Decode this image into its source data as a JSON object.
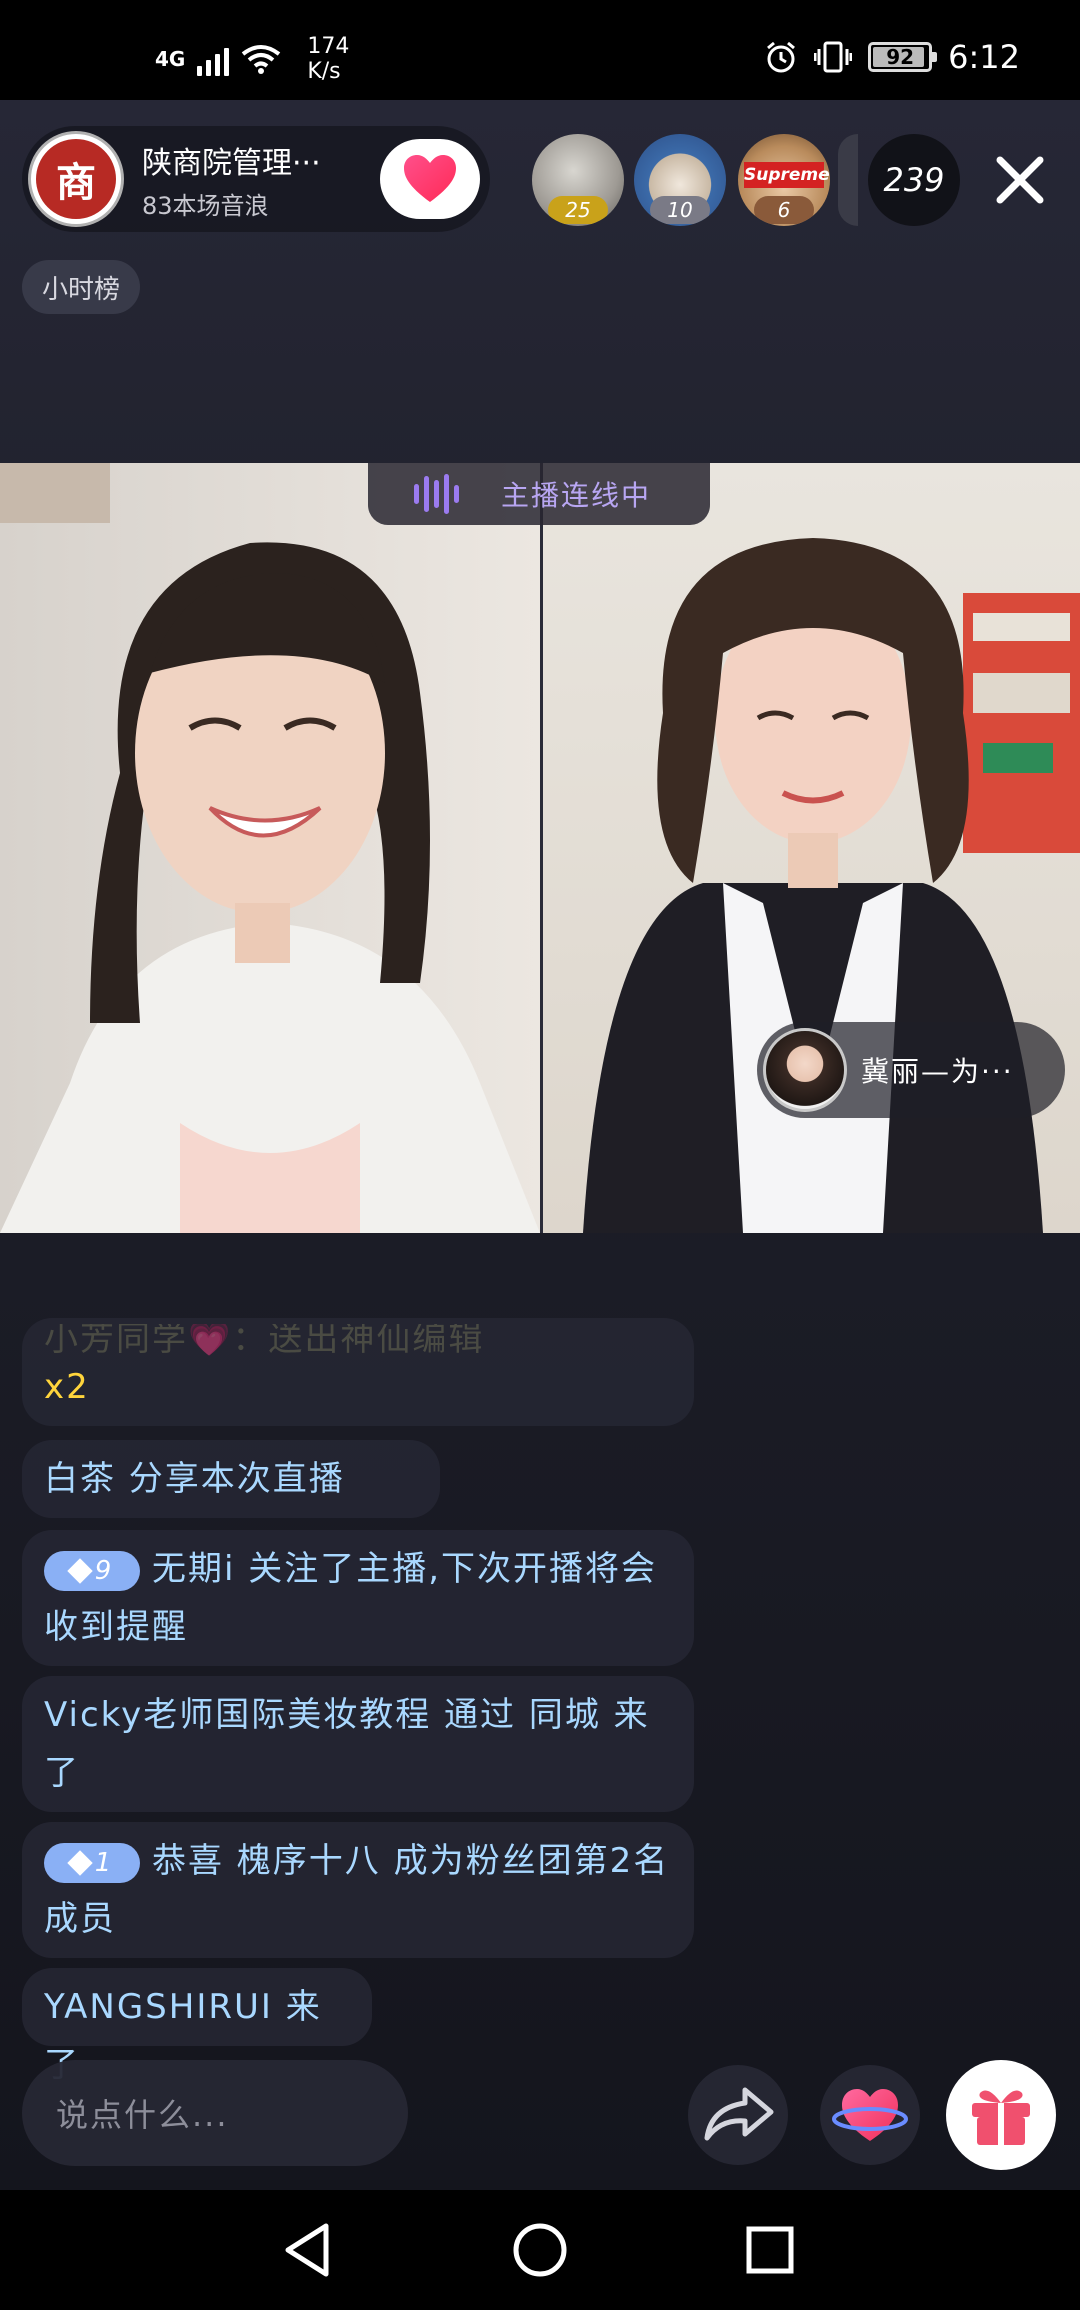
{
  "status_bar": {
    "network": "4G",
    "speed_value": "174",
    "speed_unit": "K/s",
    "battery": "92",
    "time": "6:12"
  },
  "anchor": {
    "logo_char": "商",
    "name": "陕商院管理···",
    "sub": "83本场音浪"
  },
  "viewers": [
    {
      "badge": "25",
      "badge_color": "#c9a21a"
    },
    {
      "badge": "10",
      "badge_color": "#7a7a86"
    },
    {
      "badge": "6",
      "badge_color": "#8a5a3a",
      "logo_text": "Supreme"
    }
  ],
  "viewer_count": "239",
  "rank_label": "小时榜",
  "connecting_label": "主播连线中",
  "guest_name": "冀丽—为···",
  "chat": [
    {
      "text": "小芳同学💗：送出神仙编辑",
      "extra": "x2"
    },
    {
      "text": "白茶  分享本次直播"
    },
    {
      "level": "9",
      "text": "无期i  关注了主播,下次开播将会收到提醒"
    },
    {
      "text": "Vicky老师国际美妆教程 通过 同城 来了"
    },
    {
      "level": "1",
      "text": "恭喜 槐序十八 成为粉丝团第2名成员"
    },
    {
      "text": "YANGSHIRUI 来了"
    }
  ],
  "input_placeholder": "说点什么...",
  "colors": {
    "accent_purple": "#9b7bf0",
    "chat_text": "#a9d8ff",
    "gift_pink": "#f0506e"
  }
}
